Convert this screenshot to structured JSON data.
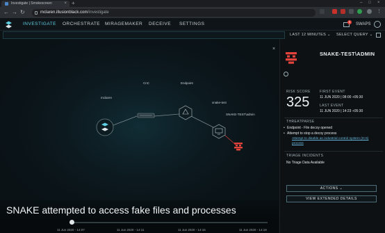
{
  "browser": {
    "tab_title": "Investigate | Smokescreen",
    "tab_close": "×",
    "new_tab": "+",
    "url_host": "mclaren.illusionblack.com",
    "url_path": "/investigate",
    "win_min": "–",
    "win_max": "□",
    "win_close": "×"
  },
  "header": {
    "nav": [
      "INVESTIGATE",
      "ORCHESTRATE",
      "MIRAGEMAKER",
      "DECEIVE",
      "SETTINGS"
    ],
    "active": "INVESTIGATE",
    "mail_badge": "9",
    "swaps_label": "SWAPS",
    "accent": "#5fd0e4"
  },
  "search": {
    "time_range": "LAST 12 MINUTES ⌄",
    "query": "SELECT QUERY ⌄"
  },
  "graph": {
    "nodes": [
      {
        "id": "mclaren",
        "label": "mclaren",
        "icon": "smokescreen-logo"
      },
      {
        "id": "cnc",
        "label": "CnC",
        "icon": "server-icon"
      },
      {
        "id": "endpoint",
        "label": "Endpoint",
        "icon": "hexagon-endpoint-icon"
      },
      {
        "id": "snake-test",
        "label": "snake-test",
        "icon": "monitor-icon"
      },
      {
        "id": "snake-admin",
        "label": "SNAKE-TEST\\admin",
        "icon": "snake-user-icon"
      }
    ],
    "close_label": "×"
  },
  "panel": {
    "title": "SNAKE-TEST\\ADMIN",
    "risk_score_label": "RISK SCORE",
    "risk_score": "325",
    "first_event_label": "FIRST EVENT",
    "first_event": "11 JUN 2020 | 08:00 +05:30",
    "last_event_label": "LAST EVENT",
    "last_event": "11 JUN 2020 | 14:23 +05:30",
    "threatparse_label": "THREATPARSE",
    "threat_items": [
      "Endpoint - File decoy opened",
      "Attempt to stop a decoy process"
    ],
    "threat_link_line1": "Attempt to disable an industrial control system (ICS)",
    "threat_link_line2": "process",
    "triage_label": "TRIAGE INCIDENTS",
    "triage_value": "No Triage Data Available",
    "actions_button": "ACTIONS ⌄",
    "extended_button": "VIEW EXTENDED DETAILS",
    "alert_color": "#e3433b"
  },
  "caption": "SNAKE attempted to access fake files and processes",
  "timeline": {
    "ticks": [
      "11 Jun 2020 - 14:07",
      "11 Jun 2020 - 14:11",
      "11 Jun 2020 - 14:15",
      "11 Jun 2020 - 14:19"
    ]
  }
}
